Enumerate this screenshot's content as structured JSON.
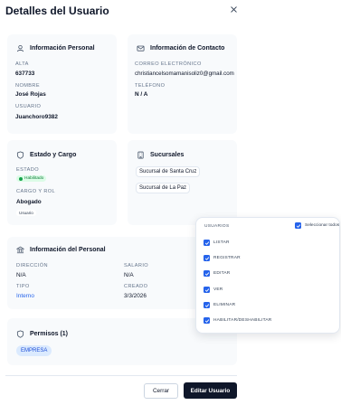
{
  "modal": {
    "title": "Detalles del Usuario"
  },
  "personal": {
    "title": "Información Personal",
    "alta_label": "ALTA",
    "alta_value": "637733",
    "nombre_label": "NOMBRE",
    "nombre_value": "José Rojas",
    "usuario_label": "USUARIO",
    "usuario_value": "Juanchoro9382"
  },
  "contact": {
    "title": "Información de Contacto",
    "email_label": "CORREO ELECTRÓNICO",
    "email_value": "christiancelsomamanisoliz0@gmail.com",
    "phone_label": "TELÉFONO",
    "phone_value": "N / A"
  },
  "status": {
    "title": "Estado y Cargo",
    "estado_label": "ESTADO",
    "estado_badge": "Habilitado",
    "cargo_label": "CARGO Y ROL",
    "cargo_value": "Abogado",
    "role_badge": "Usuario"
  },
  "branches": {
    "title": "Sucursales",
    "items": [
      "Sucursal de Santa Cruz",
      "Sucursal de La Paz"
    ]
  },
  "staff": {
    "title": "Información del Personal",
    "direccion_label": "DIRECCIÓN",
    "direccion_value": "N/A",
    "salario_label": "SALARIO",
    "salario_value": "N/A",
    "tipo_label": "TIPO",
    "tipo_value": "Interno",
    "creado_label": "CREADO",
    "creado_value": "3/3/2026"
  },
  "permissions": {
    "title": "Permisos (1)",
    "items": [
      "EMPRESA"
    ]
  },
  "footer": {
    "cancel_label": "Cerrar",
    "edit_label": "Editar Usuario"
  },
  "dropdown": {
    "header": "USUARIOS",
    "select_all_label": "Seleccionar todos",
    "options": [
      "LISTAR",
      "REGISTRAR",
      "EDITAR",
      "VER",
      "ELIMINAR",
      "HABILITAR/DESHABILITAR"
    ]
  },
  "colors": {
    "primary": "#0f172a",
    "accent": "#2563eb",
    "success": "#16a34a",
    "card_bg": "#f8fafc"
  }
}
